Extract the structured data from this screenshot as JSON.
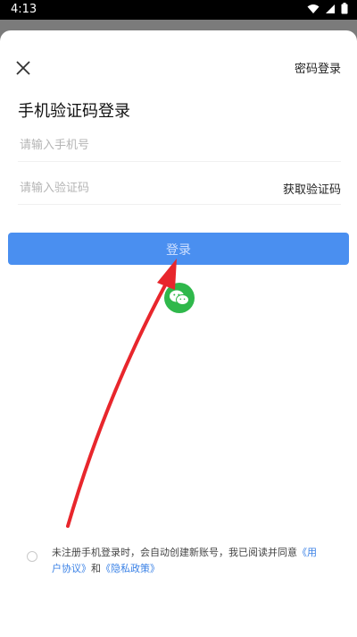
{
  "status": {
    "time": "4:13"
  },
  "header": {
    "close_icon": "close-icon",
    "password_login": "密码登录"
  },
  "title": "手机验证码登录",
  "phone": {
    "placeholder": "请输入手机号"
  },
  "code": {
    "placeholder": "请输入验证码",
    "get_code": "获取验证码"
  },
  "login_button": "登录",
  "wechat_icon": "wechat-icon",
  "colors": {
    "primary": "#4a8ff0",
    "wechat": "#2fb84b",
    "arrow": "#e8262c",
    "link": "#3b82e6"
  },
  "agreement": {
    "text1": "未注册手机登录时，会自动创建新账号，我已阅读并同意",
    "link1": "《用户协议》",
    "and": "和",
    "link2": "《隐私政策》"
  }
}
